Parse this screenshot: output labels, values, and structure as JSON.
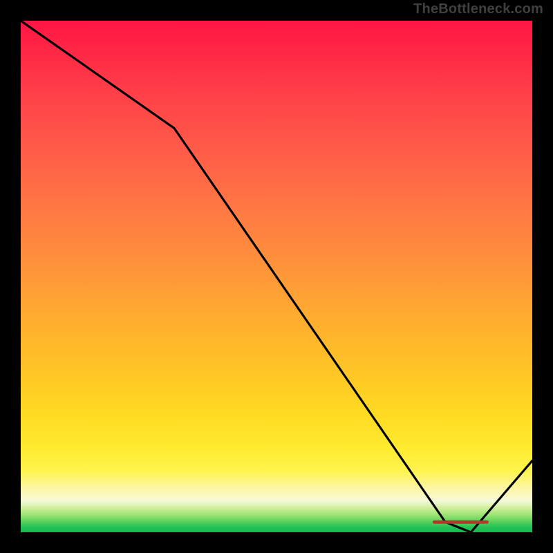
{
  "watermark": "TheBottleneck.com",
  "chart_data": {
    "type": "line",
    "x": [
      0,
      0.3,
      0.83,
      0.88,
      1.0
    ],
    "values": [
      100,
      79,
      2,
      0,
      14
    ],
    "ylim": [
      0,
      100
    ],
    "xlim": [
      0,
      1
    ],
    "title": "",
    "xlabel": "",
    "ylabel": "",
    "marker": {
      "x": 0.86,
      "y": 2,
      "label": ""
    },
    "background": "red-yellow-green vertical gradient"
  }
}
